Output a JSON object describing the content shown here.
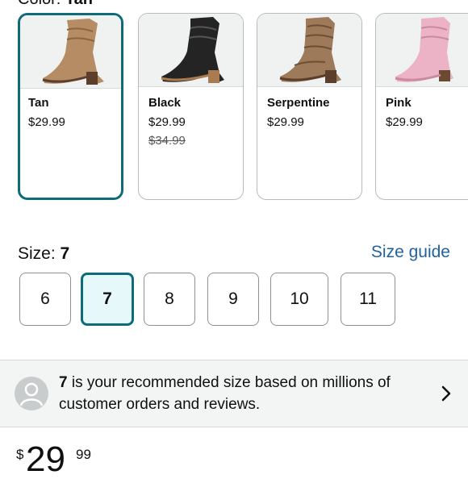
{
  "color": {
    "label": "Color:",
    "value": "Tan"
  },
  "swatches": [
    {
      "name": "Tan",
      "price": "$29.99",
      "selected": true
    },
    {
      "name": "Black",
      "price": "$29.99",
      "old_price": "$34.99"
    },
    {
      "name": "Serpentine",
      "price": "$29.99"
    },
    {
      "name": "Pink",
      "price": "$29.99"
    }
  ],
  "boot_colors": {
    "tan": "#b58c63",
    "black": "#242424",
    "serpentine": "#9d7a59",
    "pink": "#ecb3c6"
  },
  "size": {
    "label": "Size:",
    "selected": "7",
    "guide_label": "Size guide",
    "options": [
      "6",
      "7",
      "8",
      "9",
      "10",
      "11"
    ]
  },
  "recommendation": {
    "size": "7",
    "text": "is your recommended size based on millions of customer orders and reviews."
  },
  "price": {
    "symbol": "$",
    "whole": "29",
    "fraction": "99"
  },
  "colors": {
    "accent": "#0f6b7a",
    "link": "#2162a1",
    "panel": "#f3f4f4"
  }
}
